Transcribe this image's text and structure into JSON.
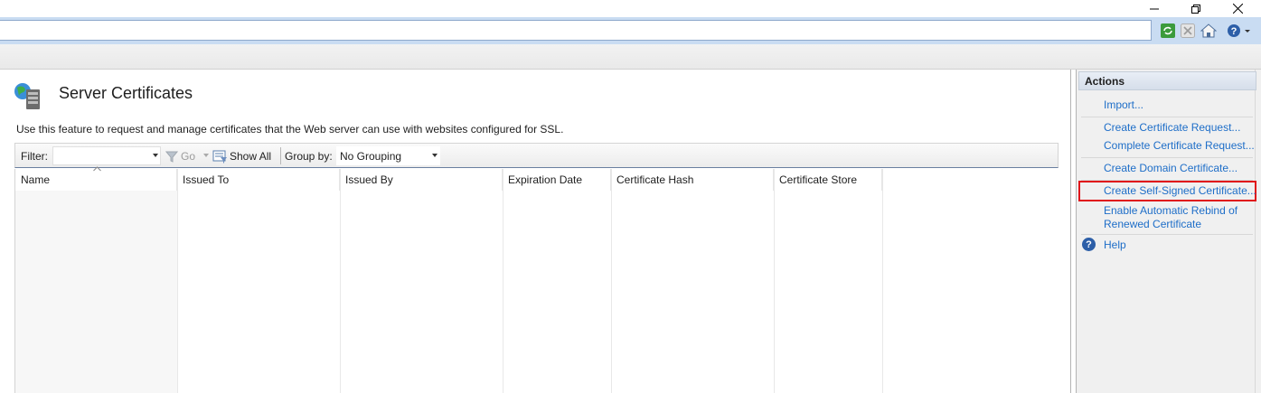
{
  "window": {
    "minimize_icon": "minimize-icon",
    "restore_icon": "restore-icon",
    "close_icon": "close-icon"
  },
  "toolbar": {
    "refresh_icon": "refresh-icon",
    "stop_icon": "stop-icon",
    "home_icon": "home-icon",
    "help_icon": "help-icon"
  },
  "feature": {
    "title": "Server Certificates",
    "description": "Use this feature to request and manage certificates that the Web server can use with websites configured for SSL."
  },
  "filter_bar": {
    "filter_label": "Filter:",
    "filter_value": "",
    "go_label": "Go",
    "show_all_label": "Show All",
    "group_by_label": "Group by:",
    "group_by_value": "No Grouping"
  },
  "grid": {
    "columns": [
      "Name",
      "Issued To",
      "Issued By",
      "Expiration Date",
      "Certificate Hash",
      "Certificate Store"
    ],
    "sorted_column": "Name",
    "rows": []
  },
  "actions": {
    "header": "Actions",
    "items": [
      "Import...",
      "Create Certificate Request...",
      "Complete Certificate Request...",
      "Create Domain Certificate...",
      "Create Self-Signed Certificate...",
      "Enable Automatic Rebind of",
      "Renewed Certificate",
      "Help"
    ],
    "highlighted": "Create Self-Signed Certificate...",
    "link_color": "#1e6ec8",
    "highlight_color": "#e0141a"
  }
}
